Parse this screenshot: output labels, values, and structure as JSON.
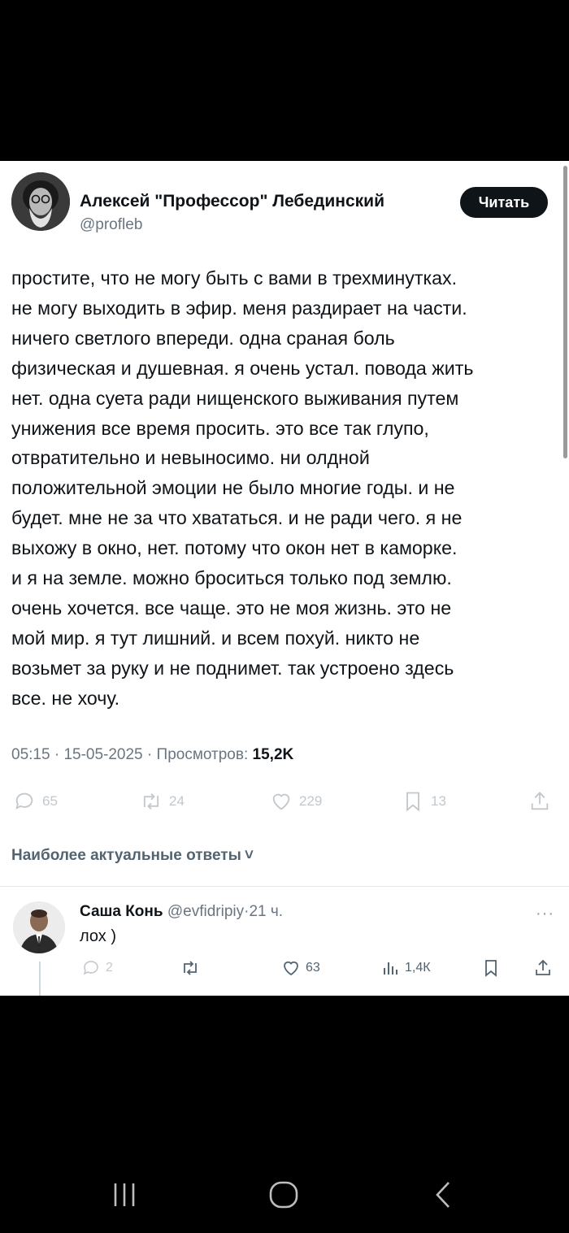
{
  "tweet": {
    "author_name": "Алексей \"Профессор\" Лебединский",
    "author_handle": "@profleb",
    "follow_label": "Читать",
    "text_lines": [
      "простите, что не могу быть с вами в трехминутках.",
      "не могу выходить в эфир. меня раздирает на части.",
      "ничего светлого впереди. одна сраная боль",
      "физическая и душевная. я очень устал. повода жить",
      "нет. одна суета ради нищенского выживания путем",
      "унижения все время просить. это все так глупо,",
      "отвратительно и невыносимо. ни олдной",
      "положительной эмоции не было многие годы. и не",
      "будет. мне не за что хвататься. и не ради чего. я не",
      "выхожу в окно, нет. потому что окон нет в каморке.",
      "и я на земле. можно броситься только под землю.",
      "очень хочется. все чаще. это не моя жизнь. это не",
      "мой мир. я тут лишний. и всем похуй. никто не",
      "возьмет за руку и не поднимет. так устроено здесь",
      "все. не хочу."
    ],
    "time": "05:15",
    "date": "15-05-2025",
    "views_label": "Просмотров:",
    "views_count": "15,2K",
    "separator": "·",
    "replies_count": "65",
    "retweets_count": "24",
    "likes_count": "229",
    "bookmarks_count": "13"
  },
  "replies_header": {
    "label": "Наиболее актуальные ответы",
    "chevron": "˅"
  },
  "reply": {
    "author_name": "Саша Конь",
    "author_handle": "@evfidripiy",
    "separator": "·",
    "time": "21 ч.",
    "text": "лох )",
    "more": "···",
    "replies_count": "2",
    "likes_count": "63",
    "views_count": "1,4К"
  },
  "colors": {
    "text": "#0f1419",
    "muted": "#6b7580",
    "faded_icons": "#c3c8cd",
    "follow_bg": "#0f1419"
  },
  "icons": {
    "reply": "reply-icon",
    "retweet": "retweet-icon",
    "like": "like-icon",
    "bookmark": "bookmark-icon",
    "share": "share-icon",
    "views": "views-icon",
    "nav_recent": "recent-apps-icon",
    "nav_home": "home-icon",
    "nav_back": "back-icon"
  }
}
